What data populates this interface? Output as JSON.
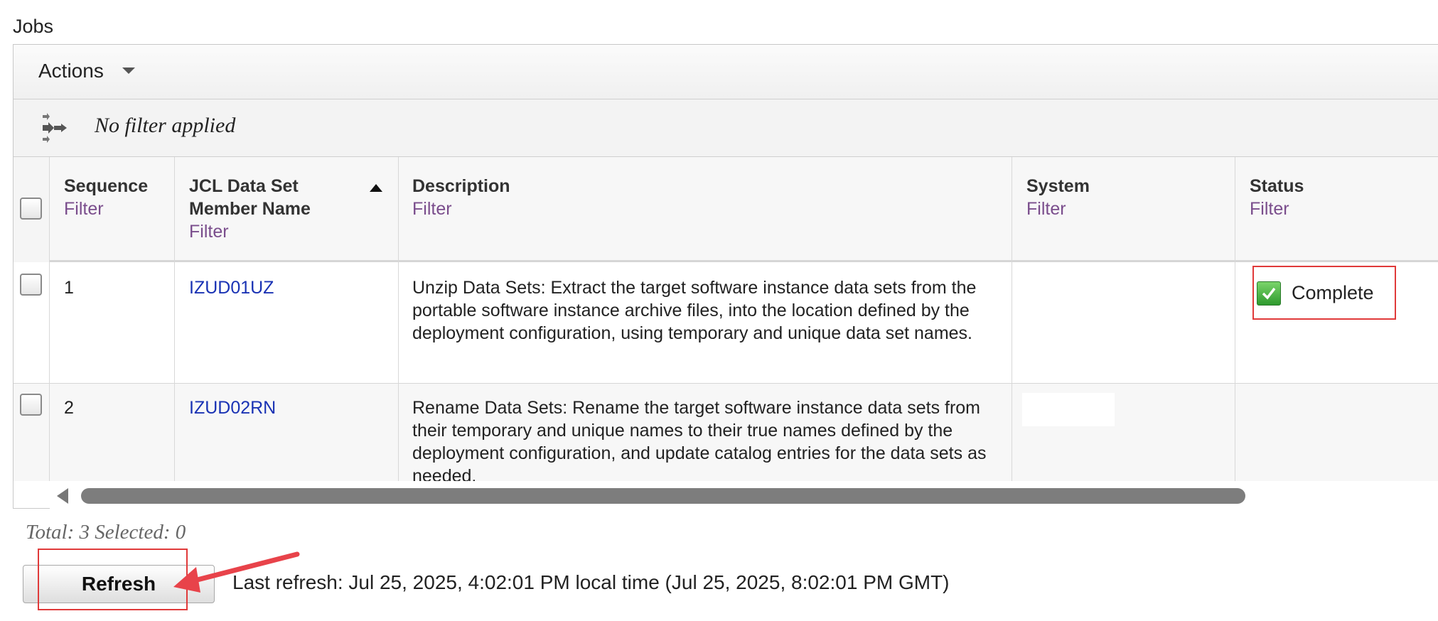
{
  "section": {
    "title": "Jobs"
  },
  "toolbar": {
    "actions_label": "Actions",
    "filter_status": "No filter applied"
  },
  "columns": [
    {
      "label": "Sequence",
      "filter": "Filter"
    },
    {
      "label": "JCL Data Set Member Name",
      "label_line1": "JCL Data Set",
      "label_line2": "Member Name",
      "filter": "Filter",
      "sorted": "ascending"
    },
    {
      "label": "Description",
      "filter": "Filter"
    },
    {
      "label": "System",
      "filter": "Filter"
    },
    {
      "label": "Status",
      "filter": "Filter"
    }
  ],
  "rows": [
    {
      "sequence": "1",
      "member": "IZUD01UZ",
      "description": "Unzip Data Sets: Extract the target software instance data sets from the portable software instance archive files, into the location defined by the deployment configuration, using temporary and unique data set names.",
      "system": "",
      "status": "Complete",
      "status_icon": "check-icon"
    },
    {
      "sequence": "2",
      "member": "IZUD02RN",
      "description": "Rename Data Sets: Rename the target software instance data sets from their temporary and unique names to their true names defined by the deployment configuration, and update catalog entries for the data sets as needed.",
      "system": "",
      "status": ""
    }
  ],
  "footer": {
    "summary": "Total: 3 Selected: 0",
    "refresh_label": "Refresh",
    "last_refresh": "Last refresh: Jul 25, 2025, 4:02:01 PM local time (Jul 25, 2025, 8:02:01 PM GMT)"
  },
  "colors": {
    "highlight": "#e03a3a",
    "link": "#1a33b4",
    "filter_link": "#7a4d8c",
    "status_complete": "#3aa33a"
  }
}
